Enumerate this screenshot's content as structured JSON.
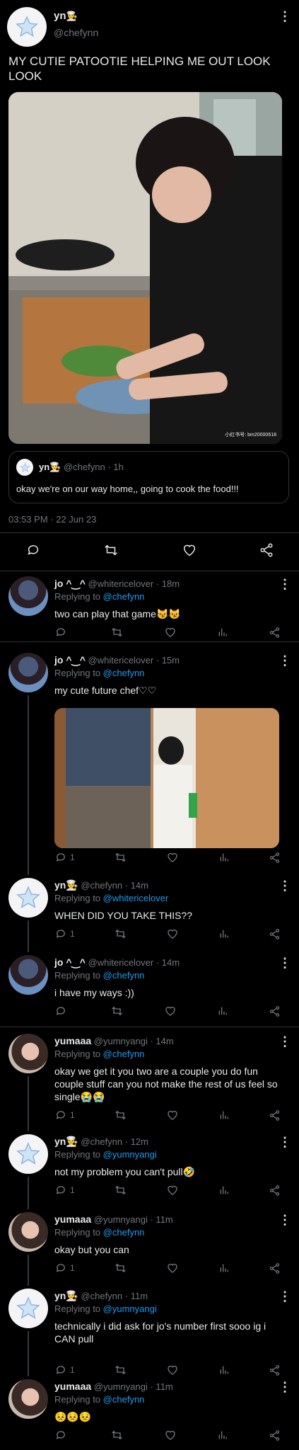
{
  "main_tweet": {
    "name": "yn",
    "name_emoji": "👨‍🍳",
    "handle": "@chefynn",
    "text": "MY CUTIE PATOOTIE HELPING ME OUT LOOK LOOK",
    "image_watermark": "小红书号: bm20000618",
    "quoted": {
      "name": "yn",
      "name_emoji": "👨‍🍳",
      "handle": "@chefynn",
      "time": "· 1h",
      "text": "okay we're on our way home,, going to cook the food!!!"
    },
    "timestamp": "03:53 PM · 22 Jun 23"
  },
  "replies": [
    {
      "name": "jo ^‿^",
      "handle": "@whitericelover",
      "time": "· 18m",
      "replying_label": "Replying to",
      "replying_to": "@chefynn",
      "text": "two can play that game😼😼",
      "count": ""
    },
    {
      "name": "jo ^‿^",
      "handle": "@whitericelover",
      "time": "· 15m",
      "replying_label": "Replying to",
      "replying_to": "@chefynn",
      "text": "my cute future chef♡♡",
      "count": "1"
    },
    {
      "name": "yn👨‍🍳",
      "handle": "@chefynn",
      "time": "· 14m",
      "replying_label": "Replying to",
      "replying_to": "@whitericelover",
      "text": "WHEN DID YOU TAKE THIS??",
      "count": "1"
    },
    {
      "name": "jo ^‿^",
      "handle": "@whitericelover",
      "time": "· 14m",
      "replying_label": "Replying to",
      "replying_to": "@chefynn",
      "text": "i have my ways :))",
      "count": ""
    },
    {
      "name": "yumaaa",
      "handle": "@yumnyangi",
      "time": "· 14m",
      "replying_label": "Replying to",
      "replying_to": "@chefynn",
      "text": "okay we get it you two are a couple you do fun couple stuff can you not make the rest of us feel so single😭😭",
      "count": "1"
    },
    {
      "name": "yn👨‍🍳",
      "handle": "@chefynn",
      "time": "· 12m",
      "replying_label": "Replying to",
      "replying_to": "@yumnyangi",
      "text": "not my problem you can't pull🤣",
      "count": "1"
    },
    {
      "name": "yumaaa",
      "handle": "@yumnyangi",
      "time": "· 11m",
      "replying_label": "Replying to",
      "replying_to": "@chefynn",
      "text": "okay but you can",
      "count": "1"
    },
    {
      "name": "yn👨‍🍳",
      "handle": "@chefynn",
      "time": "· 11m",
      "replying_label": "Replying to",
      "replying_to": "@yumnyangi",
      "text": "technically i did ask for jo's number first sooo ig i CAN pull",
      "count": "1"
    },
    {
      "name": "yumaaa",
      "handle": "@yumnyangi",
      "time": "· 11m",
      "replying_label": "Replying to",
      "replying_to": "@chefynn",
      "text": "😣😣😣",
      "count": ""
    }
  ],
  "icons": {
    "reply": "reply-icon",
    "retweet": "retweet-icon",
    "like": "heart-icon",
    "views": "views-icon",
    "share": "share-icon",
    "more": "more-icon"
  },
  "colors": {
    "background": "#000000",
    "text": "#e7e9ea",
    "muted": "#71767b",
    "link": "#1d9bf0",
    "divider": "#2f3336"
  }
}
